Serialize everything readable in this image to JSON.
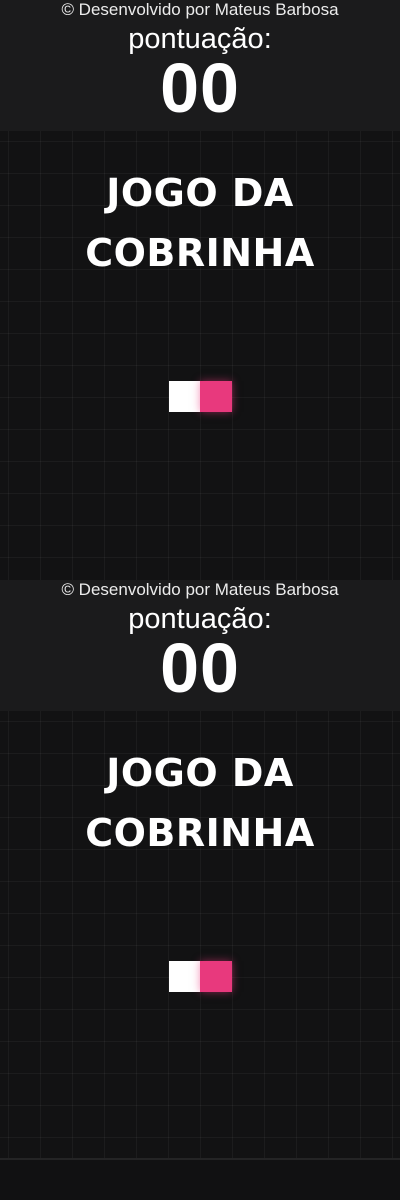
{
  "header": {
    "credit": "© Desenvolvido por Mateus Barbosa",
    "score_label": "pontuação:",
    "score_value": "00"
  },
  "game": {
    "title_line1": "JOGO DA",
    "title_line2": "COBRINHA",
    "snake_segments": [
      "body",
      "head"
    ],
    "colors": {
      "background": "#111112",
      "header": "#1b1b1c",
      "snake_body": "#ffffff",
      "snake_head": "#e8397d"
    }
  }
}
